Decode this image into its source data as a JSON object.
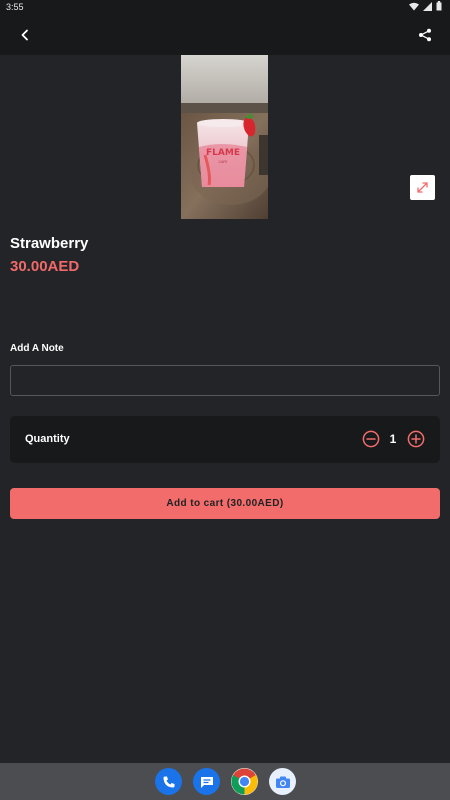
{
  "status_bar": {
    "time": "3:55"
  },
  "product": {
    "name": "Strawberry",
    "price": "30.00AED"
  },
  "note": {
    "label": "Add A Note",
    "value": "",
    "placeholder": ""
  },
  "quantity": {
    "label": "Quantity",
    "value": "1"
  },
  "cart_button": {
    "label": "Add to cart (30.00AED)"
  },
  "colors": {
    "background": "#232427",
    "bar": "#18191b",
    "accent": "#f26c6c",
    "price": "#f06a6a"
  },
  "icons": {
    "back": "arrow-left-icon",
    "share": "share-icon",
    "expand": "expand-icon",
    "minus": "minus-circle-icon",
    "plus": "plus-circle-icon",
    "dock": [
      "phone-icon",
      "messages-icon",
      "chrome-icon",
      "camera-icon"
    ]
  }
}
